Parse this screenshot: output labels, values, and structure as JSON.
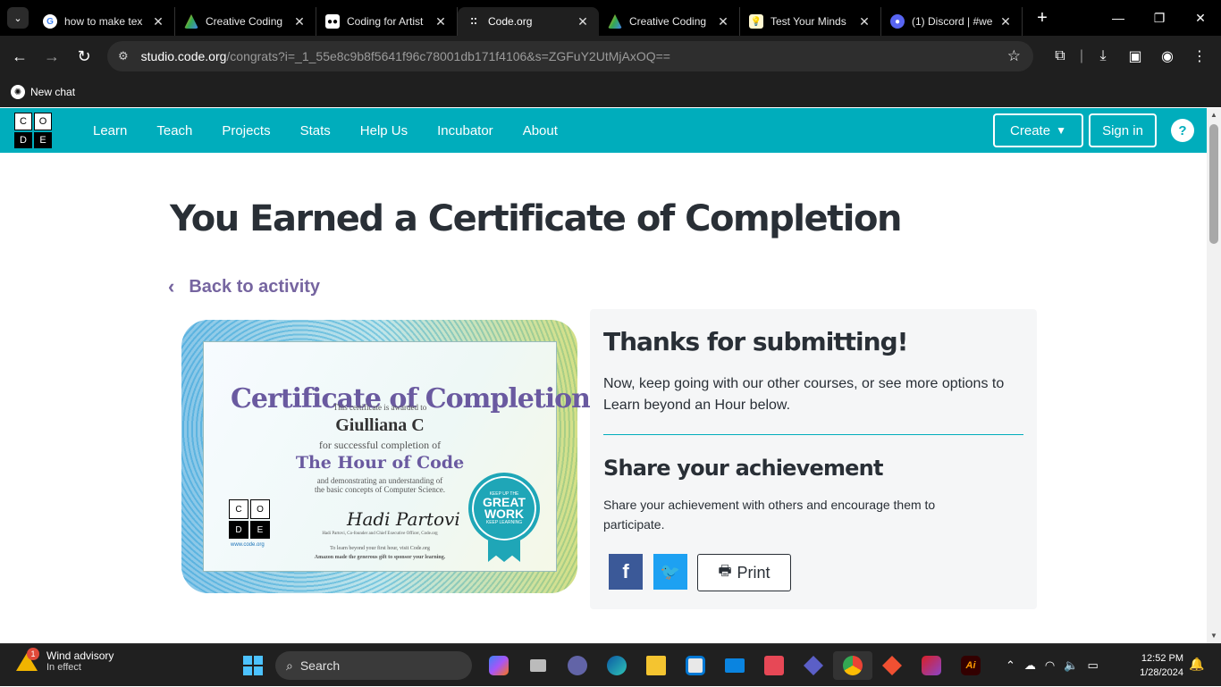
{
  "browser": {
    "tabs": [
      {
        "title": "how to make tex",
        "favicon": "google-icon",
        "active": false
      },
      {
        "title": "Creative Coding",
        "favicon": "drive-icon",
        "active": false
      },
      {
        "title": "Coding for Artist",
        "favicon": "medium-icon",
        "active": false
      },
      {
        "title": "Code.org",
        "favicon": "codeorg-icon",
        "active": true
      },
      {
        "title": "Creative Coding",
        "favicon": "drive-icon",
        "active": false
      },
      {
        "title": "Test Your Minds",
        "favicon": "bulb-icon",
        "active": false
      },
      {
        "title": "(1) Discord | #we",
        "favicon": "discord-icon",
        "active": false
      }
    ],
    "url_host": "studio.code.org",
    "url_rest": "/congrats?i=_1_55e8c9b8f5641f96c78001db171f4106&s=ZGFuY2UtMjAxOQ==",
    "bookmark": "New chat"
  },
  "site": {
    "logo_letters": [
      "C",
      "O",
      "D",
      "E"
    ],
    "nav": [
      "Learn",
      "Teach",
      "Projects",
      "Stats",
      "Help Us",
      "Incubator",
      "About"
    ],
    "create_label": "Create",
    "signin_label": "Sign in",
    "help_label": "?"
  },
  "page": {
    "title": "You Earned a Certificate of Completion",
    "back_label": "Back to activity"
  },
  "certificate": {
    "heading": "Certificate of Completion",
    "awarded": "This certificate is awarded to",
    "name": "Giulliana C",
    "for": "for successful completion of",
    "course": "The Hour of Code",
    "demo1": "and demonstrating an understanding of",
    "demo2": "the basic concepts of Computer Science.",
    "signature": "Hadi Partovi",
    "signer": "Hadi Partovi, Co-founder and Chief Executive Officer, Code.org",
    "footer1": "To learn beyond your first hour, visit Code.org",
    "footer2": "Amazon made the generous gift to sponsor your learning.",
    "url": "www.code.org",
    "seal_top": "KEEP UP THE",
    "seal_main": "GREAT WORK",
    "seal_bottom": "KEEP LEARNING"
  },
  "card": {
    "title": "Thanks for submitting!",
    "text": "Now, keep going with our other courses, or see more options to Learn beyond an Hour below.",
    "share_title": "Share your achievement",
    "share_text": "Share your achievement with others and encourage them to participate.",
    "print_label": "Print"
  },
  "taskbar": {
    "weather_title": "Wind advisory",
    "weather_sub": "In effect",
    "weather_badge": "1",
    "search_label": "Search",
    "time": "12:52 PM",
    "date": "1/28/2024"
  }
}
